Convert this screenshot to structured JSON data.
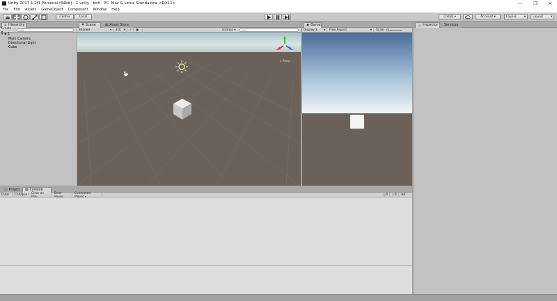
{
  "window": {
    "title": "Unity 2017.1.1f1 Personal (64bit) - 1.unity - boll - PC, Mac & Linux Standalone <DX11>",
    "minimize": "—",
    "maximize": "❐",
    "close": "✕"
  },
  "menu": [
    "File",
    "Edit",
    "Assets",
    "GameObject",
    "Component",
    "Window",
    "Help"
  ],
  "toolbar": {
    "pivot_label": "Center",
    "space_label": "Local",
    "collab_label": "Collab ▾",
    "account_label": "Account ▾",
    "layers_label": "Layers",
    "layout_label": "Layout"
  },
  "hierarchy": {
    "tab": "Hierarchy",
    "create_label": "Create ▾",
    "search_placeholder": "All",
    "scene_name": "1",
    "items": [
      "Main Camera",
      "Directional Light",
      "Cube"
    ]
  },
  "scene": {
    "tabs": [
      "Scene",
      "Asset Store"
    ],
    "shading": "Shaded",
    "mode_2d": "2D",
    "gizmos_label": "Gizmos ▾",
    "search_placeholder": "All",
    "persp_label": "< Persp"
  },
  "game": {
    "tab": "Game",
    "display": "Display 1",
    "aspect": "Free Aspect",
    "scale_label": "Scale"
  },
  "inspector": {
    "tabs": [
      "Inspector",
      "Services"
    ]
  },
  "console": {
    "tabs": [
      "Project",
      "Console"
    ],
    "buttons": [
      "Clear",
      "Collapse",
      "Clear on Play",
      "Error Pause",
      "Connected Player ▾"
    ],
    "counts": [
      "0",
      "0",
      "0"
    ]
  },
  "colors": {
    "ground": "#6a625a",
    "sky_top": "#a8c4cc",
    "panel": "#c2c2c2",
    "tab_active": "#d8d8d8"
  }
}
